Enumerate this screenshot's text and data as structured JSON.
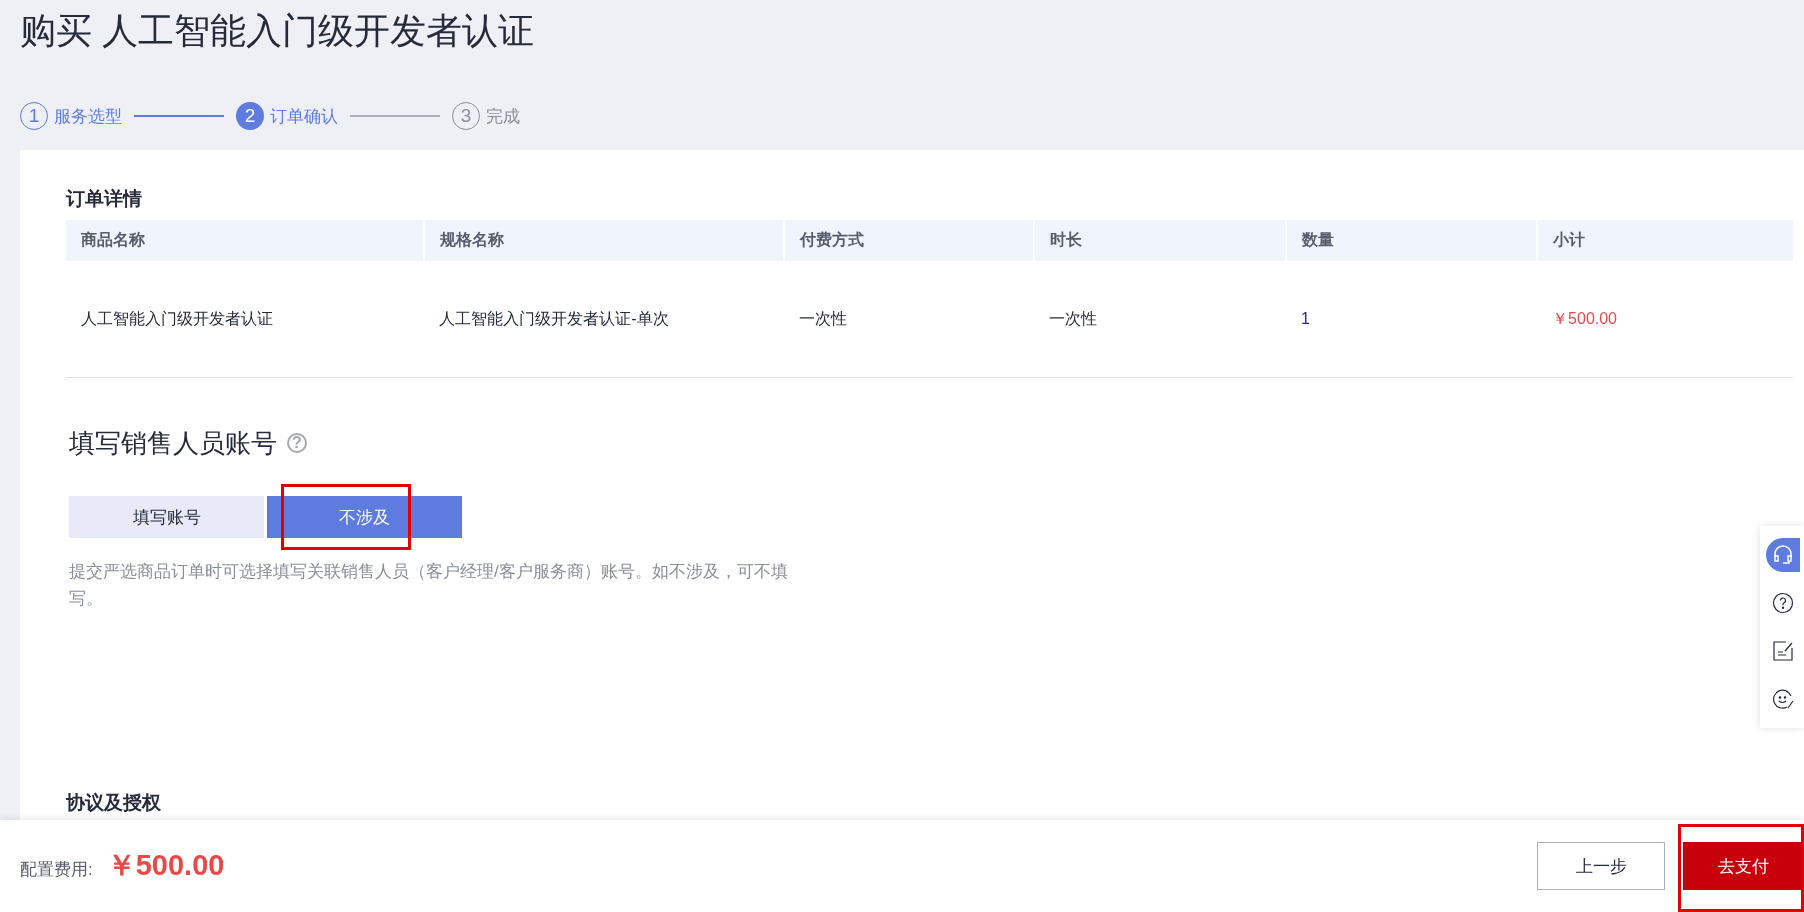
{
  "page_title": "购买 人工智能入门级开发者认证",
  "steps": [
    {
      "number": "1",
      "label": "服务选型",
      "completed": true,
      "selected": false
    },
    {
      "number": "2",
      "label": "订单确认",
      "completed": false,
      "selected": true
    },
    {
      "number": "3",
      "label": "完成",
      "completed": false,
      "selected": false
    }
  ],
  "order": {
    "title": "订单详情",
    "columns": [
      "商品名称",
      "规格名称",
      "付费方式",
      "时长",
      "数量",
      "小计"
    ],
    "rows": [
      [
        "人工智能入门级开发者认证",
        "人工智能入门级开发者认证-单次",
        "一次性",
        "一次性",
        "1",
        "￥500.00"
      ]
    ]
  },
  "sales": {
    "title": "填写销售人员账号",
    "help_icon": "?",
    "options": [
      {
        "label": "填写账号",
        "selected": false,
        "annotated": false
      },
      {
        "label": "不涉及",
        "selected": true,
        "annotated": true
      }
    ],
    "note": "提交严选商品订单时可选择填写关联销售人员（客户经理/客户服务商）账号。如不涉及，可不填写。"
  },
  "agreement_title": "协议及授权",
  "side_tools": [
    {
      "kind": "headset",
      "selected": true
    },
    {
      "kind": "help",
      "selected": false
    },
    {
      "kind": "note",
      "selected": false
    },
    {
      "kind": "smile",
      "selected": false
    }
  ],
  "footer": {
    "fee_label": "配置费用:",
    "fee": "￥500.00",
    "prev_button": "上一步",
    "pay_button": {
      "label": "去支付",
      "annotated": true
    }
  }
}
